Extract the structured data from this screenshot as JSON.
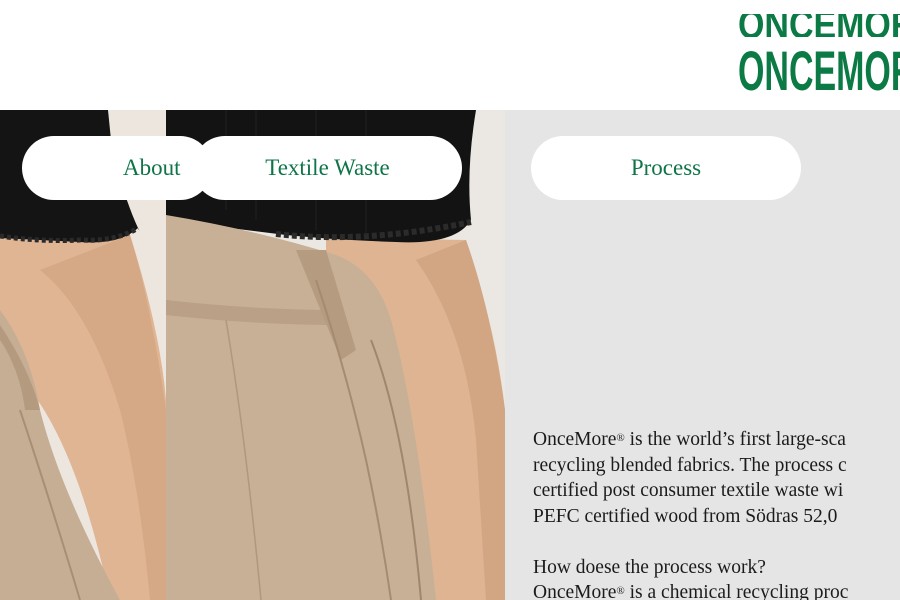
{
  "brand": {
    "logo_text": "ONCEMORE",
    "logo_color": "#0b7a45"
  },
  "nav": {
    "about_label": "About",
    "textile_waste_label": "Textile Waste",
    "process_label": "Process"
  },
  "content": {
    "intro_lines": [
      {
        "before": "OnceMore",
        "mark": "®",
        "after": " is the world’s first large-sca"
      },
      {
        "before": "recycling blended fabrics. The process c",
        "mark": "",
        "after": ""
      },
      {
        "before": "certified post consumer textile waste wi",
        "mark": "",
        "after": ""
      },
      {
        "before": "PEFC certified wood from Södras 52,0",
        "mark": "",
        "after": ""
      }
    ],
    "question": "How doese the process work?",
    "answer_start": {
      "before": "OnceMore",
      "mark": "®",
      "after": " is a chemical recycling proc"
    }
  },
  "colors": {
    "accent_green": "#0f7448",
    "text": "#1b1b1b",
    "panel_grey": "#e5e5e5",
    "sweater_black": "#141414",
    "skirt_beige": "#c4ad93"
  }
}
